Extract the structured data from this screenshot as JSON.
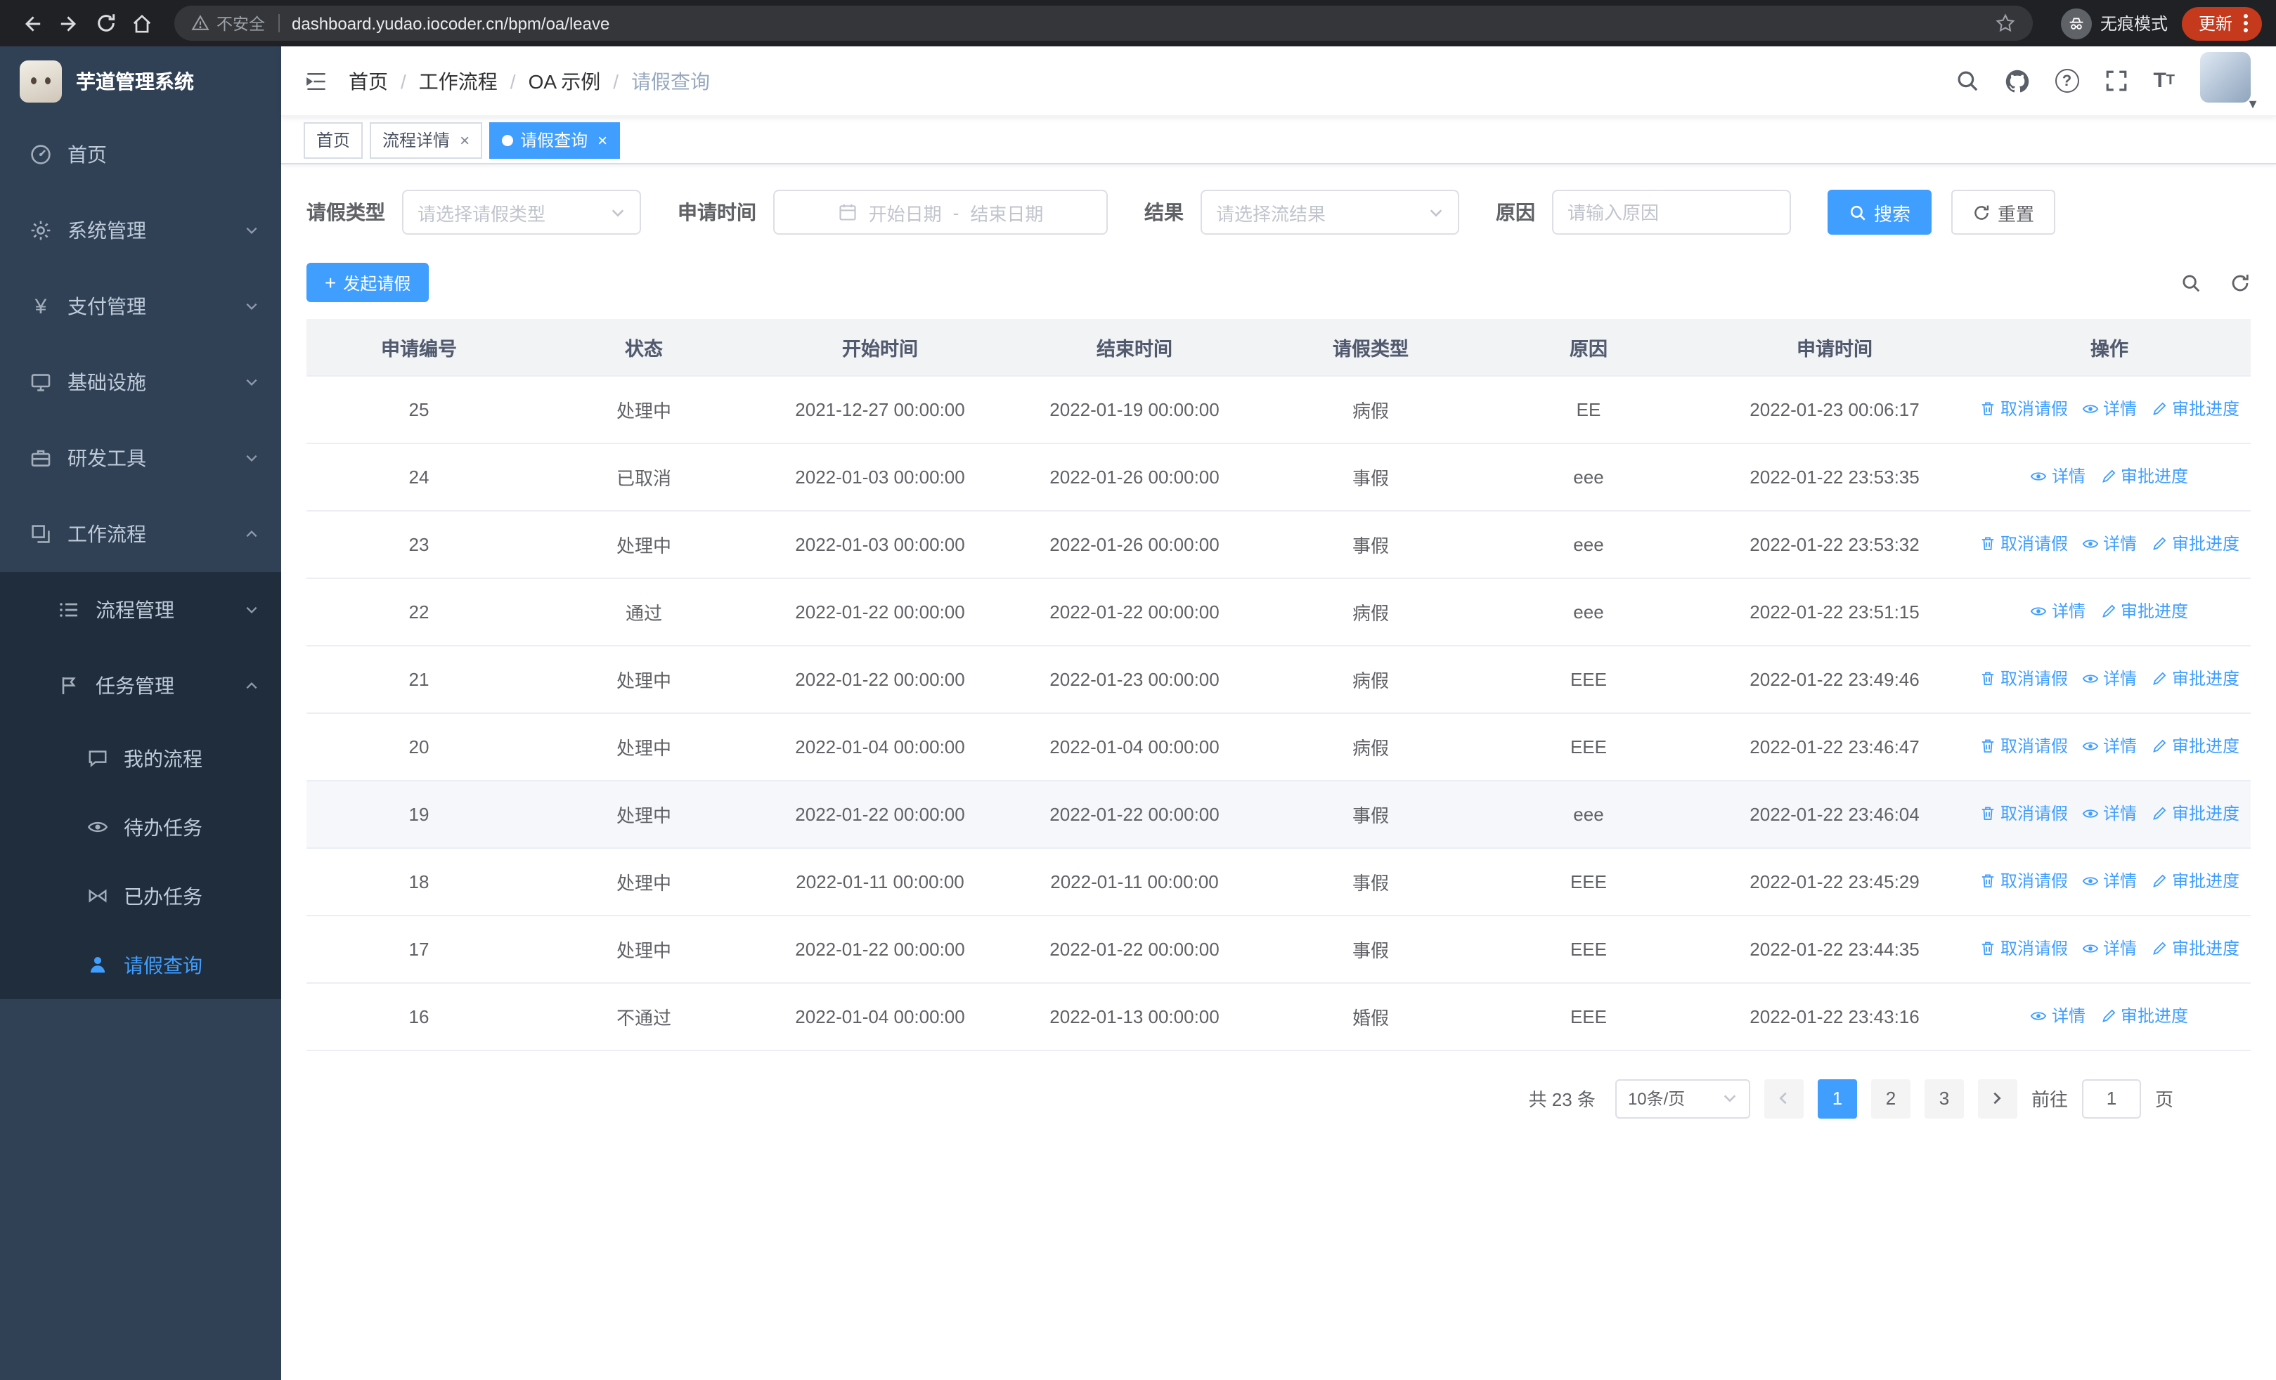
{
  "colors": {
    "primary": "#409eff"
  },
  "browser": {
    "security_label": "不安全",
    "url": "dashboard.yudao.iocoder.cn/bpm/oa/leave",
    "incognito_label": "无痕模式",
    "update_label": "更新"
  },
  "sidebar": {
    "app_title": "芋道管理系统",
    "menu": {
      "home": "首页",
      "system": "系统管理",
      "payment": "支付管理",
      "infrastructure": "基础设施",
      "devtools": "研发工具",
      "workflow": "工作流程",
      "process_mgmt": "流程管理",
      "task_mgmt": "任务管理",
      "my_process": "我的流程",
      "todo_task": "待办任务",
      "done_task": "已办任务",
      "leave_query": "请假查询"
    }
  },
  "breadcrumb": [
    "首页",
    "工作流程",
    "OA 示例",
    "请假查询"
  ],
  "tags": [
    {
      "label": "首页"
    },
    {
      "label": "流程详情"
    },
    {
      "label": "请假查询"
    }
  ],
  "filters": {
    "leave_type": {
      "label": "请假类型",
      "placeholder": "请选择请假类型"
    },
    "apply_time": {
      "label": "申请时间",
      "start_placeholder": "开始日期",
      "separator": "-",
      "end_placeholder": "结束日期"
    },
    "result": {
      "label": "结果",
      "placeholder": "请选择流结果"
    },
    "reason": {
      "label": "原因",
      "placeholder": "请输入原因"
    },
    "search_label": "搜索",
    "reset_label": "重置"
  },
  "toolbar": {
    "create_label": "发起请假"
  },
  "table": {
    "columns": [
      "申请编号",
      "状态",
      "开始时间",
      "结束时间",
      "请假类型",
      "原因",
      "申请时间",
      "操作"
    ],
    "action_labels": {
      "cancel": "取消请假",
      "detail": "详情",
      "progress": "审批进度"
    },
    "rows": [
      {
        "id": "25",
        "status": "处理中",
        "start": "2021-12-27 00:00:00",
        "end": "2022-01-19 00:00:00",
        "type": "病假",
        "reason": "EE",
        "applied": "2022-01-23 00:06:17",
        "actions": [
          "cancel",
          "detail",
          "progress"
        ],
        "highlighted": false
      },
      {
        "id": "24",
        "status": "已取消",
        "start": "2022-01-03 00:00:00",
        "end": "2022-01-26 00:00:00",
        "type": "事假",
        "reason": "eee",
        "applied": "2022-01-22 23:53:35",
        "actions": [
          "detail",
          "progress"
        ],
        "highlighted": false
      },
      {
        "id": "23",
        "status": "处理中",
        "start": "2022-01-03 00:00:00",
        "end": "2022-01-26 00:00:00",
        "type": "事假",
        "reason": "eee",
        "applied": "2022-01-22 23:53:32",
        "actions": [
          "cancel",
          "detail",
          "progress"
        ],
        "highlighted": false
      },
      {
        "id": "22",
        "status": "通过",
        "start": "2022-01-22 00:00:00",
        "end": "2022-01-22 00:00:00",
        "type": "病假",
        "reason": "eee",
        "applied": "2022-01-22 23:51:15",
        "actions": [
          "detail",
          "progress"
        ],
        "highlighted": false
      },
      {
        "id": "21",
        "status": "处理中",
        "start": "2022-01-22 00:00:00",
        "end": "2022-01-23 00:00:00",
        "type": "病假",
        "reason": "EEE",
        "applied": "2022-01-22 23:49:46",
        "actions": [
          "cancel",
          "detail",
          "progress"
        ],
        "highlighted": false
      },
      {
        "id": "20",
        "status": "处理中",
        "start": "2022-01-04 00:00:00",
        "end": "2022-01-04 00:00:00",
        "type": "病假",
        "reason": "EEE",
        "applied": "2022-01-22 23:46:47",
        "actions": [
          "cancel",
          "detail",
          "progress"
        ],
        "highlighted": false
      },
      {
        "id": "19",
        "status": "处理中",
        "start": "2022-01-22 00:00:00",
        "end": "2022-01-22 00:00:00",
        "type": "事假",
        "reason": "eee",
        "applied": "2022-01-22 23:46:04",
        "actions": [
          "cancel",
          "detail",
          "progress"
        ],
        "highlighted": true
      },
      {
        "id": "18",
        "status": "处理中",
        "start": "2022-01-11 00:00:00",
        "end": "2022-01-11 00:00:00",
        "type": "事假",
        "reason": "EEE",
        "applied": "2022-01-22 23:45:29",
        "actions": [
          "cancel",
          "detail",
          "progress"
        ],
        "highlighted": false
      },
      {
        "id": "17",
        "status": "处理中",
        "start": "2022-01-22 00:00:00",
        "end": "2022-01-22 00:00:00",
        "type": "事假",
        "reason": "EEE",
        "applied": "2022-01-22 23:44:35",
        "actions": [
          "cancel",
          "detail",
          "progress"
        ],
        "highlighted": false
      },
      {
        "id": "16",
        "status": "不通过",
        "start": "2022-01-04 00:00:00",
        "end": "2022-01-13 00:00:00",
        "type": "婚假",
        "reason": "EEE",
        "applied": "2022-01-22 23:43:16",
        "actions": [
          "detail",
          "progress"
        ],
        "highlighted": false
      }
    ]
  },
  "pagination": {
    "total_label": "共 23 条",
    "page_size_label": "10条/页",
    "pages": [
      "1",
      "2",
      "3"
    ],
    "active_page": "1",
    "goto_label": "前往",
    "goto_value": "1",
    "goto_suffix": "页"
  }
}
